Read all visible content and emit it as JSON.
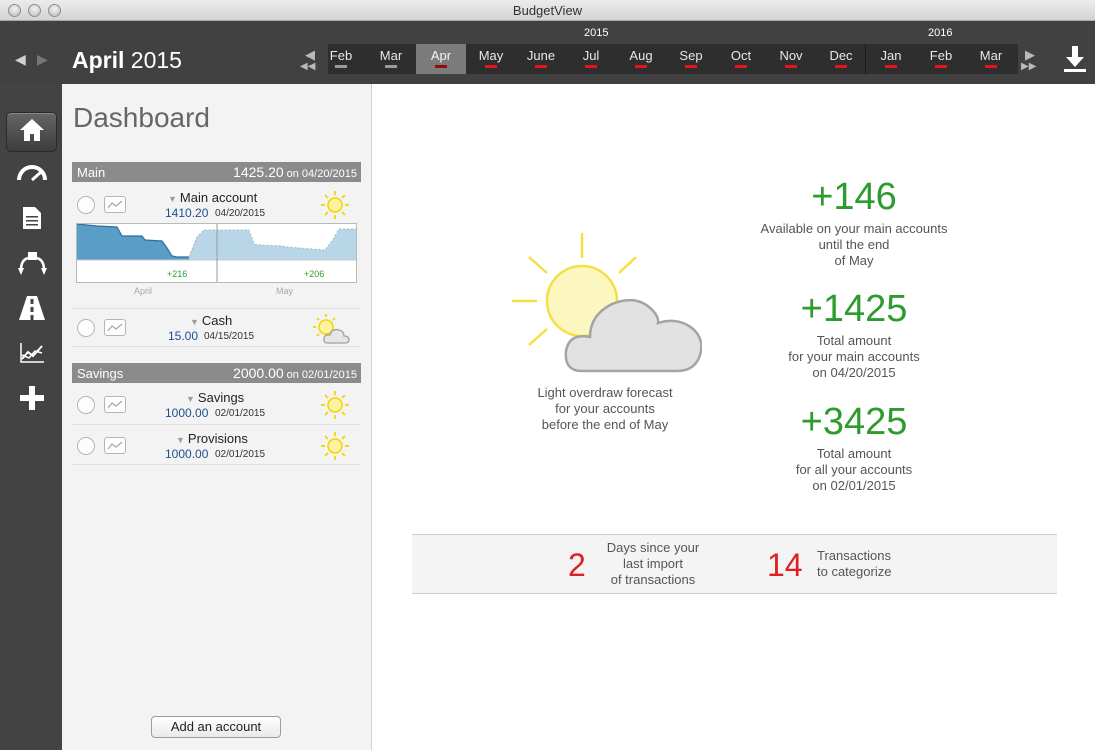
{
  "window": {
    "title": "BudgetView"
  },
  "header": {
    "month_bold": "April",
    "month_year": "2015",
    "years": [
      "2015",
      "2016"
    ],
    "months": [
      {
        "label": "Feb",
        "bar": "grey"
      },
      {
        "label": "Mar",
        "bar": "grey"
      },
      {
        "label": "Apr",
        "bar": "red",
        "selected": true
      },
      {
        "label": "May",
        "bar": "red"
      },
      {
        "label": "June",
        "bar": "red"
      },
      {
        "label": "Jul",
        "bar": "red"
      },
      {
        "label": "Aug",
        "bar": "red"
      },
      {
        "label": "Sep",
        "bar": "red"
      },
      {
        "label": "Oct",
        "bar": "red"
      },
      {
        "label": "Nov",
        "bar": "red"
      },
      {
        "label": "Dec",
        "bar": "red"
      },
      {
        "label": "Jan",
        "bar": "red"
      },
      {
        "label": "Feb",
        "bar": "red"
      },
      {
        "label": "Mar",
        "bar": "red"
      }
    ]
  },
  "iconbar": [
    "home-icon",
    "budget-gauge-icon",
    "document-icon",
    "categorize-icon",
    "road-icon",
    "analysis-chart-icon",
    "plus-icon"
  ],
  "dashboard": {
    "title": "Dashboard",
    "groups": [
      {
        "name": "Main",
        "amount": "1425.20",
        "date": "on 04/20/2015",
        "accounts": [
          {
            "name": "Main account",
            "value": "1410.20",
            "date": "04/20/2015",
            "weather": "sunny",
            "chart": {
              "label_left": "+216",
              "label_right": "+206",
              "month_left": "April",
              "month_right": "May"
            }
          },
          {
            "name": "Cash",
            "value": "15.00",
            "date": "04/15/2015",
            "weather": "sun-cloud"
          }
        ]
      },
      {
        "name": "Savings",
        "amount": "2000.00",
        "date": "on 02/01/2015",
        "accounts": [
          {
            "name": "Savings",
            "value": "1000.00",
            "date": "02/01/2015",
            "weather": "sunny"
          },
          {
            "name": "Provisions",
            "value": "1000.00",
            "date": "02/01/2015",
            "weather": "sunny"
          }
        ]
      }
    ],
    "add_account_label": "Add an account"
  },
  "main": {
    "forecast_lines": [
      "Light overdraw forecast",
      "for your accounts",
      "before the end of May"
    ],
    "stats": [
      {
        "value": "+146",
        "lines": [
          "Available on your main accounts",
          "until the end",
          "of May"
        ]
      },
      {
        "value": "+1425",
        "lines": [
          "Total amount",
          "for your main accounts",
          "on 04/20/2015"
        ]
      },
      {
        "value": "+3425",
        "lines": [
          "Total amount",
          "for all your accounts",
          "on 02/01/2015"
        ]
      }
    ],
    "days_since_import": "2",
    "days_since_lines": [
      "Days since your",
      "last import",
      "of transactions"
    ],
    "to_categorize": "14",
    "to_categorize_lines": [
      "Transactions",
      "to categorize"
    ]
  },
  "colors": {
    "positive": "#2e9b2e",
    "alert": "#e02020",
    "value_blue": "#1f4f8f"
  }
}
